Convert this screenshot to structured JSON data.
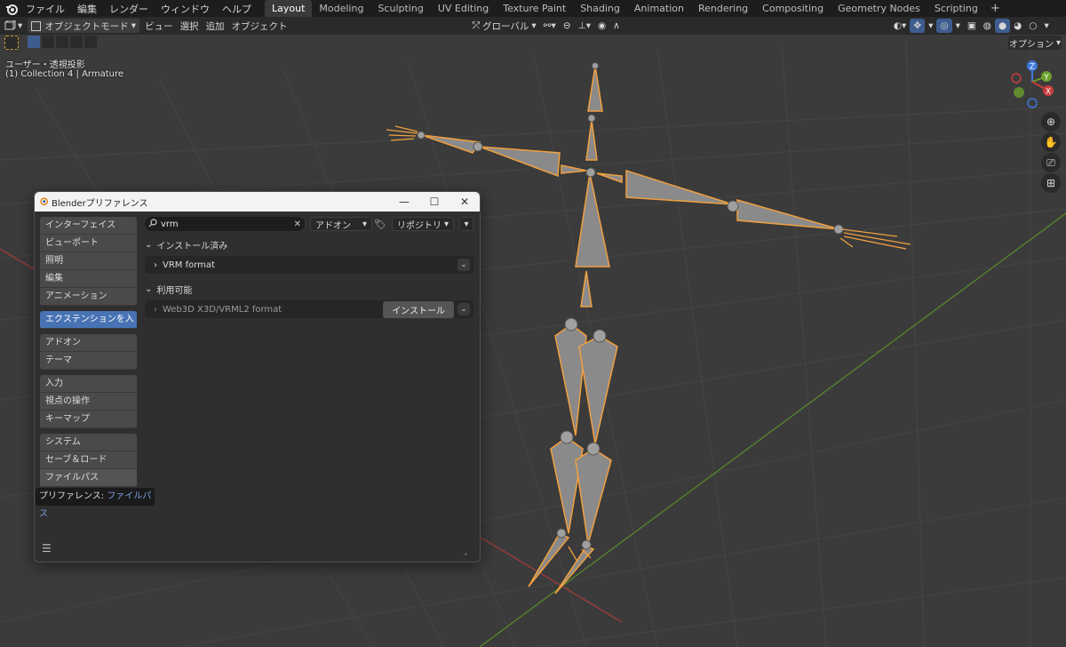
{
  "topbar": {
    "menus": [
      "ファイル",
      "編集",
      "レンダー",
      "ウィンドウ",
      "ヘルプ"
    ],
    "workspaces": [
      "Layout",
      "Modeling",
      "Sculpting",
      "UV Editing",
      "Texture Paint",
      "Shading",
      "Animation",
      "Rendering",
      "Compositing",
      "Geometry Nodes",
      "Scripting"
    ],
    "active_workspace": "Layout",
    "add_tab": "+"
  },
  "header": {
    "mode": "オブジェクトモード",
    "menus": [
      "ビュー",
      "選択",
      "追加",
      "オブジェクト"
    ],
    "orientation": "グローバル"
  },
  "viewport": {
    "view_name": "ユーザー・透視投影",
    "collection": "(1) Collection 4 | Armature",
    "options": "オプション",
    "gizmo": {
      "z": "Z",
      "y": "Y",
      "x": "X"
    }
  },
  "prefs": {
    "title": "Blenderプリファレンス",
    "sidebar_groups": [
      [
        "インターフェイス",
        "ビューポート",
        "照明",
        "編集",
        "アニメーション"
      ],
      [
        "エクステンションを入手"
      ],
      [
        "アドオン",
        "テーマ"
      ],
      [
        "入力",
        "視点の操作",
        "キーマップ"
      ],
      [
        "システム",
        "セーブ＆ロード",
        "ファイルパス"
      ]
    ],
    "selected_item": "エクステンションを入手",
    "tooltip": {
      "label": "プリファレンス:",
      "value": "ファイルパス"
    },
    "search": {
      "value": "vrm"
    },
    "filter_type": "アドオン",
    "repository": "リポジトリ",
    "installed_section": "インストール済み",
    "installed": [
      {
        "name": "VRM format"
      }
    ],
    "available_section": "利用可能",
    "available": [
      {
        "name": "Web3D X3D/VRML2 format",
        "button": "インストール"
      }
    ]
  },
  "colors": {
    "accent": "#4772b3",
    "armature_outline": "#f0a040",
    "x_axis": "#c83c3c",
    "y_axis": "#6ca02c"
  }
}
